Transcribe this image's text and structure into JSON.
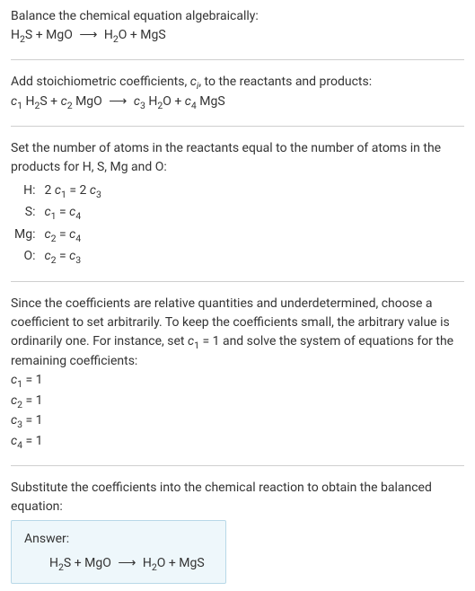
{
  "intro": {
    "line1": "Balance the chemical equation algebraically:"
  },
  "eq1": {
    "r1a": "H",
    "r1sub": "2",
    "r1b": "S + MgO",
    "arrow": "⟶",
    "p1a": "H",
    "p1sub": "2",
    "p1b": "O + MgS"
  },
  "stoich": {
    "line_a": "Add stoichiometric coefficients, ",
    "ci": "c",
    "ci_sub": "i",
    "line_b": ", to the reactants and products:"
  },
  "eq2": {
    "c1": "c",
    "c1sub": "1",
    "sp1a": " H",
    "sp1sub": "2",
    "sp1b": "S + ",
    "c2": "c",
    "c2sub": "2",
    "sp2": " MgO",
    "arrow": "⟶",
    "c3": "c",
    "c3sub": "3",
    "sp3a": " H",
    "sp3sub": "2",
    "sp3b": "O + ",
    "c4": "c",
    "c4sub": "4",
    "sp4": " MgS"
  },
  "atoms": {
    "intro": "Set the number of atoms in the reactants equal to the number of atoms in the products for H, S, Mg and O:",
    "rows": {
      "h_label": "H:",
      "h_lhs_a": "2 ",
      "h_lhs_c": "c",
      "h_lhs_sub": "1",
      "h_eq": " = ",
      "h_rhs_a": "2 ",
      "h_rhs_c": "c",
      "h_rhs_sub": "3",
      "s_label": "S:",
      "s_lhs_c": "c",
      "s_lhs_sub": "1",
      "s_eq": " = ",
      "s_rhs_c": "c",
      "s_rhs_sub": "4",
      "mg_label": "Mg:",
      "mg_lhs_c": "c",
      "mg_lhs_sub": "2",
      "mg_eq": " = ",
      "mg_rhs_c": "c",
      "mg_rhs_sub": "4",
      "o_label": "O:",
      "o_lhs_c": "c",
      "o_lhs_sub": "2",
      "o_eq": " = ",
      "o_rhs_c": "c",
      "o_rhs_sub": "3"
    }
  },
  "choose": {
    "text_a": "Since the coefficients are relative quantities and underdetermined, choose a coefficient to set arbitrarily. To keep the coefficients small, the arbitrary value is ordinarily one. For instance, set ",
    "cvar": "c",
    "csub": "1",
    "text_b": " = 1 and solve the system of equations for the remaining coefficients:",
    "l1a": "c",
    "l1sub": "1",
    "l1b": " = 1",
    "l2a": "c",
    "l2sub": "2",
    "l2b": " = 1",
    "l3a": "c",
    "l3sub": "3",
    "l3b": " = 1",
    "l4a": "c",
    "l4sub": "4",
    "l4b": " = 1"
  },
  "subst": {
    "text": "Substitute the coefficients into the chemical reaction to obtain the balanced equation:"
  },
  "answer": {
    "label": "Answer:",
    "r1a": "H",
    "r1sub": "2",
    "r1b": "S + MgO",
    "arrow": "⟶",
    "p1a": "H",
    "p1sub": "2",
    "p1b": "O + MgS"
  }
}
